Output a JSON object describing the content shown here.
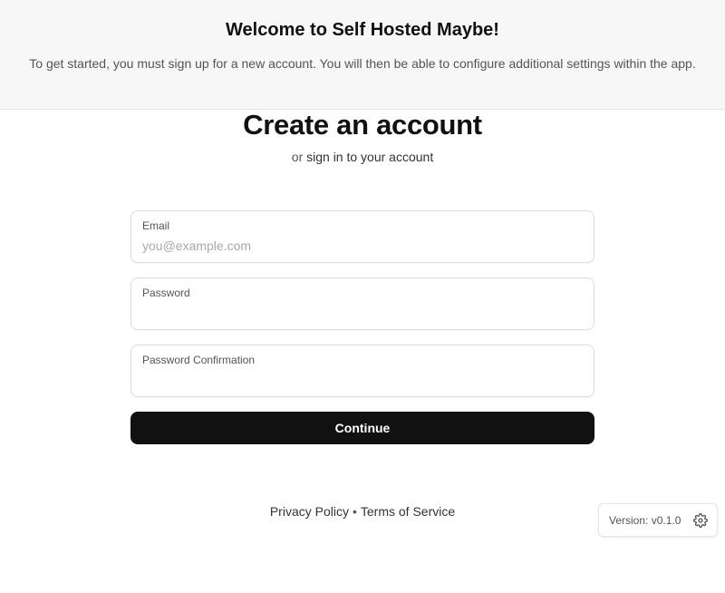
{
  "banner": {
    "title": "Welcome to Self Hosted Maybe!",
    "text": "To get started, you must sign up for a new account. You will then be able to configure additional settings within the app."
  },
  "header": {
    "title": "Create an account",
    "subtitle_prefix": "or",
    "signin_link": "sign in to your account"
  },
  "form": {
    "email_label": "Email",
    "email_placeholder": "you@example.com",
    "email_value": "",
    "password_label": "Password",
    "password_value": "",
    "password_confirmation_label": "Password Confirmation",
    "password_confirmation_value": "",
    "submit_label": "Continue"
  },
  "footer": {
    "privacy_label": "Privacy Policy",
    "separator": "•",
    "terms_label": "Terms of Service"
  },
  "version": {
    "label": "Version: v0.1.0",
    "icon": "gear-icon"
  },
  "colors": {
    "primary_button": "#111111",
    "banner_bg": "#f7f7f7",
    "muted_text": "#545454"
  }
}
